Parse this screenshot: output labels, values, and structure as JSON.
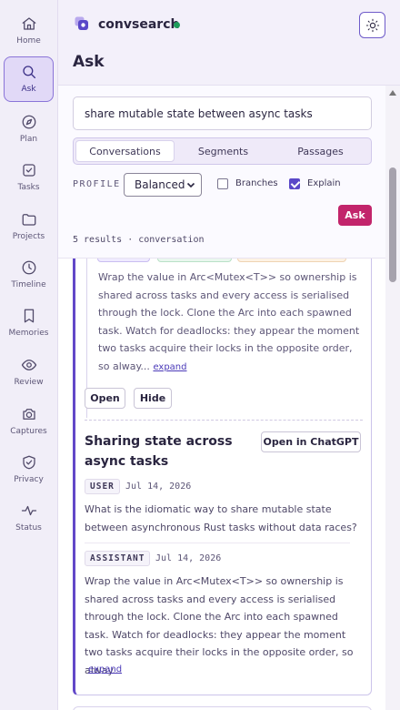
{
  "app": {
    "name": "convsearch",
    "status_color": "#1e9c5a",
    "accent": "#6248c8",
    "ask_color": "#c2246b"
  },
  "nav": [
    {
      "label": "Home",
      "icon": "home-icon"
    },
    {
      "label": "Ask",
      "icon": "search-icon",
      "active": true
    },
    {
      "label": "Plan",
      "icon": "compass-icon"
    },
    {
      "label": "Tasks",
      "icon": "checkbox-icon"
    },
    {
      "label": "Projects",
      "icon": "folder-icon"
    },
    {
      "label": "Timeline",
      "icon": "clock-icon"
    },
    {
      "label": "Memories",
      "icon": "bookmark-icon"
    },
    {
      "label": "Review",
      "icon": "eye-icon"
    },
    {
      "label": "Captures",
      "icon": "camera-icon"
    },
    {
      "label": "Privacy",
      "icon": "shield-icon"
    },
    {
      "label": "Status",
      "icon": "pulse-icon"
    }
  ],
  "page": {
    "title": "Ask"
  },
  "search": {
    "value": "share mutable state between async tasks",
    "tabs": [
      "Conversations",
      "Segments",
      "Passages"
    ],
    "active_tab": "Conversations",
    "profile_label": "PROFILE",
    "profile_value": "Balanced",
    "branches_label": "Branches",
    "branches_checked": false,
    "explain_label": "Explain",
    "explain_checked": true,
    "ask_label": "Ask",
    "results_meta": "5 results · conversation"
  },
  "results": {
    "segment": {
      "text": "Wrap the value in Arc<Mutex<T>> so ownership is shared across tasks and every access is serialised through the lock. Clone the Arc into each spawned task. Watch for deadlocks: they appear the moment two tasks acquire their locks in the opposite order, so alway...",
      "expand_label": "expand",
      "open_label": "Open",
      "hide_label": "Hide"
    },
    "conversation": {
      "title": "Sharing state across async tasks",
      "open_chatgpt_label": "Open in ChatGPT",
      "messages": [
        {
          "role": "USER",
          "date": "Jul 14, 2026",
          "text": "What is the idiomatic way to share mutable state between asynchronous Rust tasks without data races?"
        },
        {
          "role": "ASSISTANT",
          "date": "Jul 14, 2026",
          "text": "Wrap the value in Arc<Mutex<T>> so ownership is shared across tasks and every access is serialised through the lock. Clone the Arc into each spawned task. Watch for deadlocks: they appear the moment two tasks acquire their locks in the opposite order, so alway...",
          "expand_label": "expand"
        }
      ]
    }
  }
}
